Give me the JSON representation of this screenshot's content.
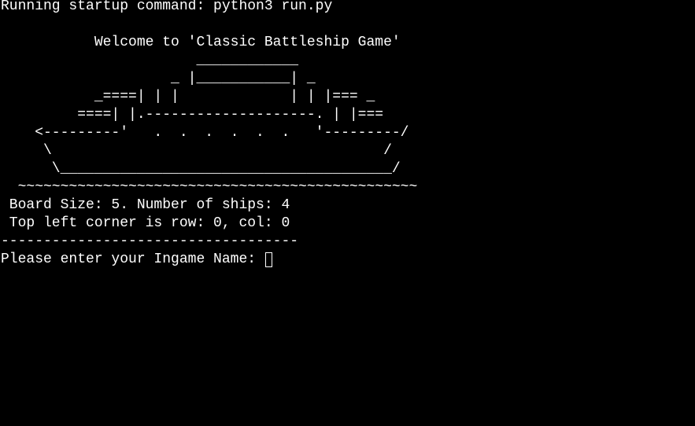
{
  "terminal": {
    "startup_line": "Running startup command: python3 run.py",
    "welcome_line": "           Welcome to 'Classic Battleship Game'",
    "ship_art": [
      "                       ____________",
      "                    _ |___________| _",
      "           _====| | |             | | |=== _",
      "         ====| |.--------------------. | |===",
      "    <---------'   .  .  .  .  .  .   '---------/",
      "     \\                                       /",
      "      \\_______________________________________/",
      "  ~~~~~~~~~~~~~~~~~~~~~~~~~~~~~~~~~~~~~~~~~~~~~~~"
    ],
    "board_size_line": " Board Size: 5. Number of ships: 4",
    "corner_line": " Top left corner is row: 0, col: 0",
    "separator_line": "-----------------------------------",
    "prompt_label": "Please enter your Ingame Name: ",
    "input_value": ""
  }
}
